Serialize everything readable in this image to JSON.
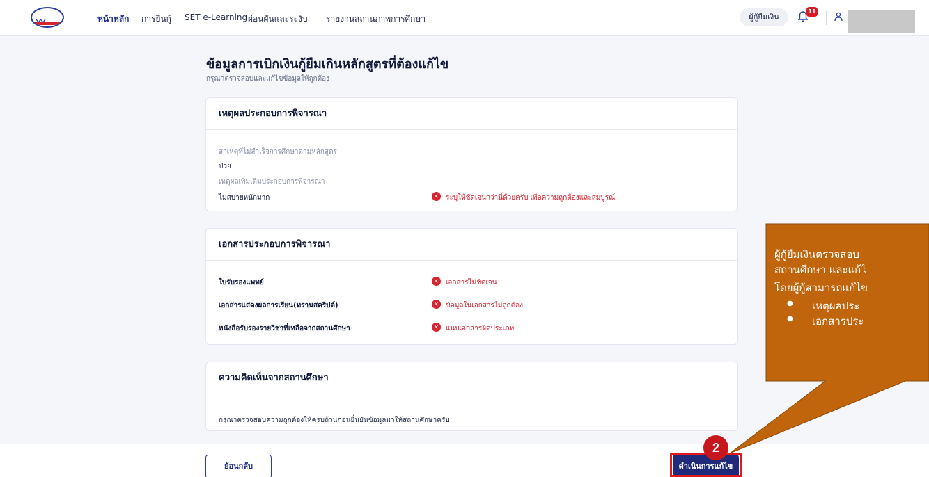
{
  "nav": {
    "items": [
      "หน้าหลัก",
      "การยื่นกู้",
      "SET e-Learning",
      "ผ่อนผันและระงับ",
      "รายงานสถานภาพการศึกษา"
    ],
    "role": "ผู้กู้ยืมเงิน",
    "notification_count": "11"
  },
  "page": {
    "title": "ข้อมูลการเบิกเงินกู้ยืมเกินหลักสูตรที่ต้องแก้ไข",
    "subtitle": "กรุณาตรวจสอบและแก้ไขข้อมูลให้ถูกต้อง"
  },
  "reason_card": {
    "heading": "เหตุผลประกอบการพิจารณา",
    "cause_label": "สาเหตุที่ไม่สำเร็จการศึกษาตามหลักสูตร",
    "cause_value": "ป่วย",
    "extra_label": "เหตุผลเพิ่มเติมประกอบการพิจารณา",
    "extra_value": "ไม่สบายหนักมาก",
    "extra_error": "ระบุให้ชัดเจนกว่านี้ด้วยครับ เพื่อความถูกต้องและสมบูรณ์"
  },
  "docs_card": {
    "heading": "เอกสารประกอบการพิจารณา",
    "rows": [
      {
        "name": "ใบรับรองแพทย์",
        "error": "เอกสารไม่ชัดเจน"
      },
      {
        "name": "เอกสารแสดงผลการเรียน(ทรานสคริปต์)",
        "error": "ข้อมูลในเอกสารไม่ถูกต้อง"
      },
      {
        "name": "หนังสือรับรองรายวิชาที่เหลือจากสถานศึกษา",
        "error": "แนบเอกสารผิดประเภท"
      }
    ]
  },
  "comment_card": {
    "heading": "ความคิดเห็นจากสถานศึกษา",
    "text": "กรุณาตรวจสอบความถูกต้องให้ครบถ้วนก่อนยื่นยันข้อมูลมาให้สถานศึกษาครับ"
  },
  "footer": {
    "back_label": "ย้อนกลับ",
    "proceed_label": "ดำเนินการแก้ไข"
  },
  "callout": {
    "step": "2",
    "line1": "ผู้กู้ยืมเงินตรวจสอบ",
    "line2": "สถานศึกษา และแก้ไ",
    "line3": "โดยผู้กู้สามารถแก้ไข",
    "bullets": [
      "เหตุผลประ",
      "เอกสารประ"
    ],
    "fill_color": "#c0650c"
  }
}
